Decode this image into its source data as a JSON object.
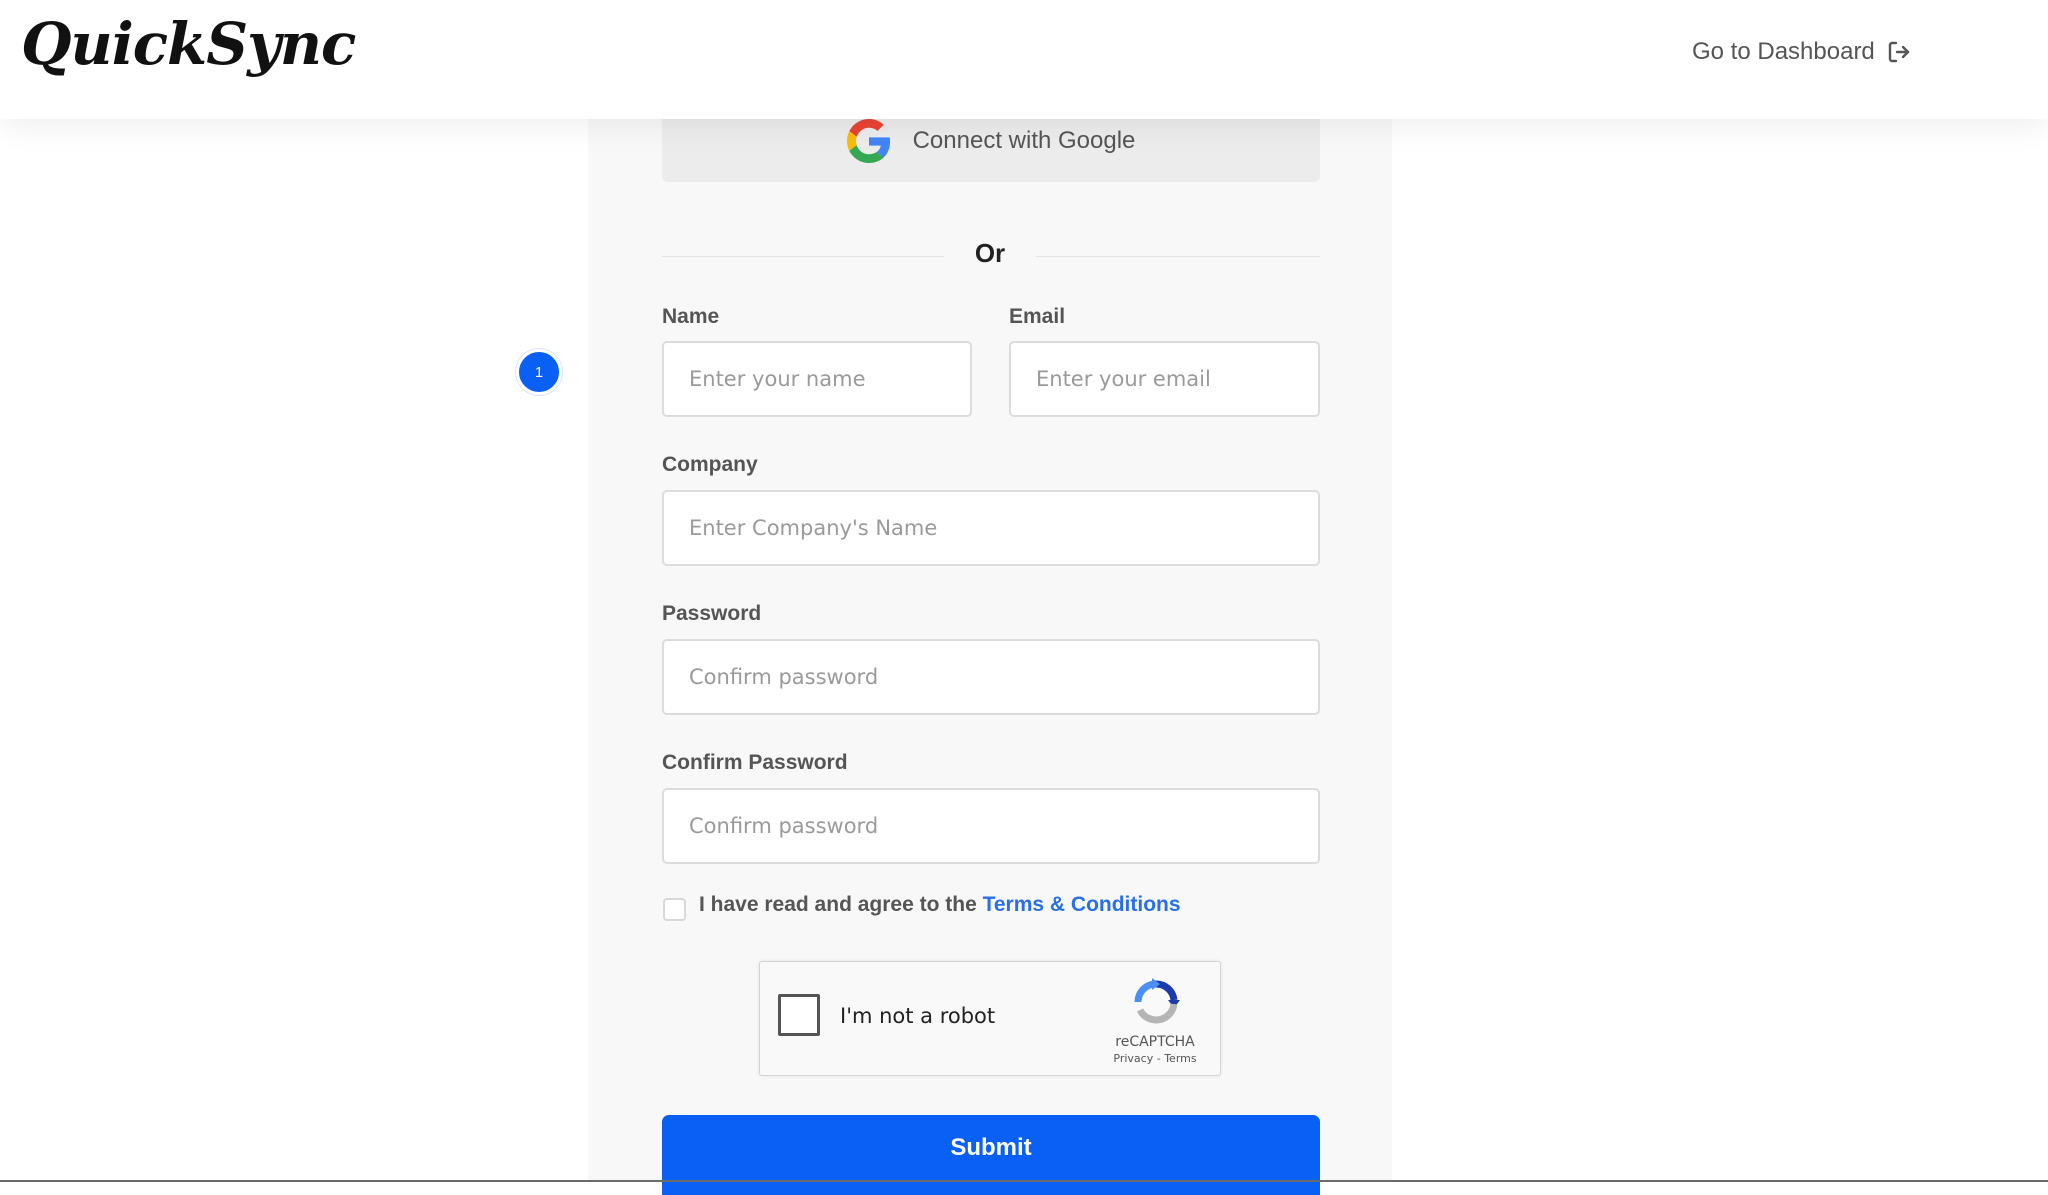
{
  "header": {
    "logo_text": "QuickSync",
    "dashboard_link": "Go to Dashboard"
  },
  "google_button": {
    "label": "Connect with Google"
  },
  "divider": {
    "text": "Or"
  },
  "step_badge": "1",
  "form": {
    "name": {
      "label": "Name",
      "placeholder": "Enter your name"
    },
    "email": {
      "label": "Email",
      "placeholder": "Enter your email"
    },
    "company": {
      "label": "Company",
      "placeholder": "Enter Company's Name"
    },
    "password": {
      "label": "Password",
      "placeholder": "Confirm password"
    },
    "confirm_password": {
      "label": "Confirm Password",
      "placeholder": "Confirm password"
    },
    "terms": {
      "prefix": "I have read and agree to the ",
      "link": "Terms & Conditions"
    },
    "submit_label": "Submit"
  },
  "recaptcha": {
    "label": "I'm not a robot",
    "brand": "reCAPTCHA",
    "links": "Privacy - Terms"
  },
  "colors": {
    "primary": "#0a5ff5",
    "link": "#2a6fe8",
    "panel_bg": "#f8f8f8"
  }
}
